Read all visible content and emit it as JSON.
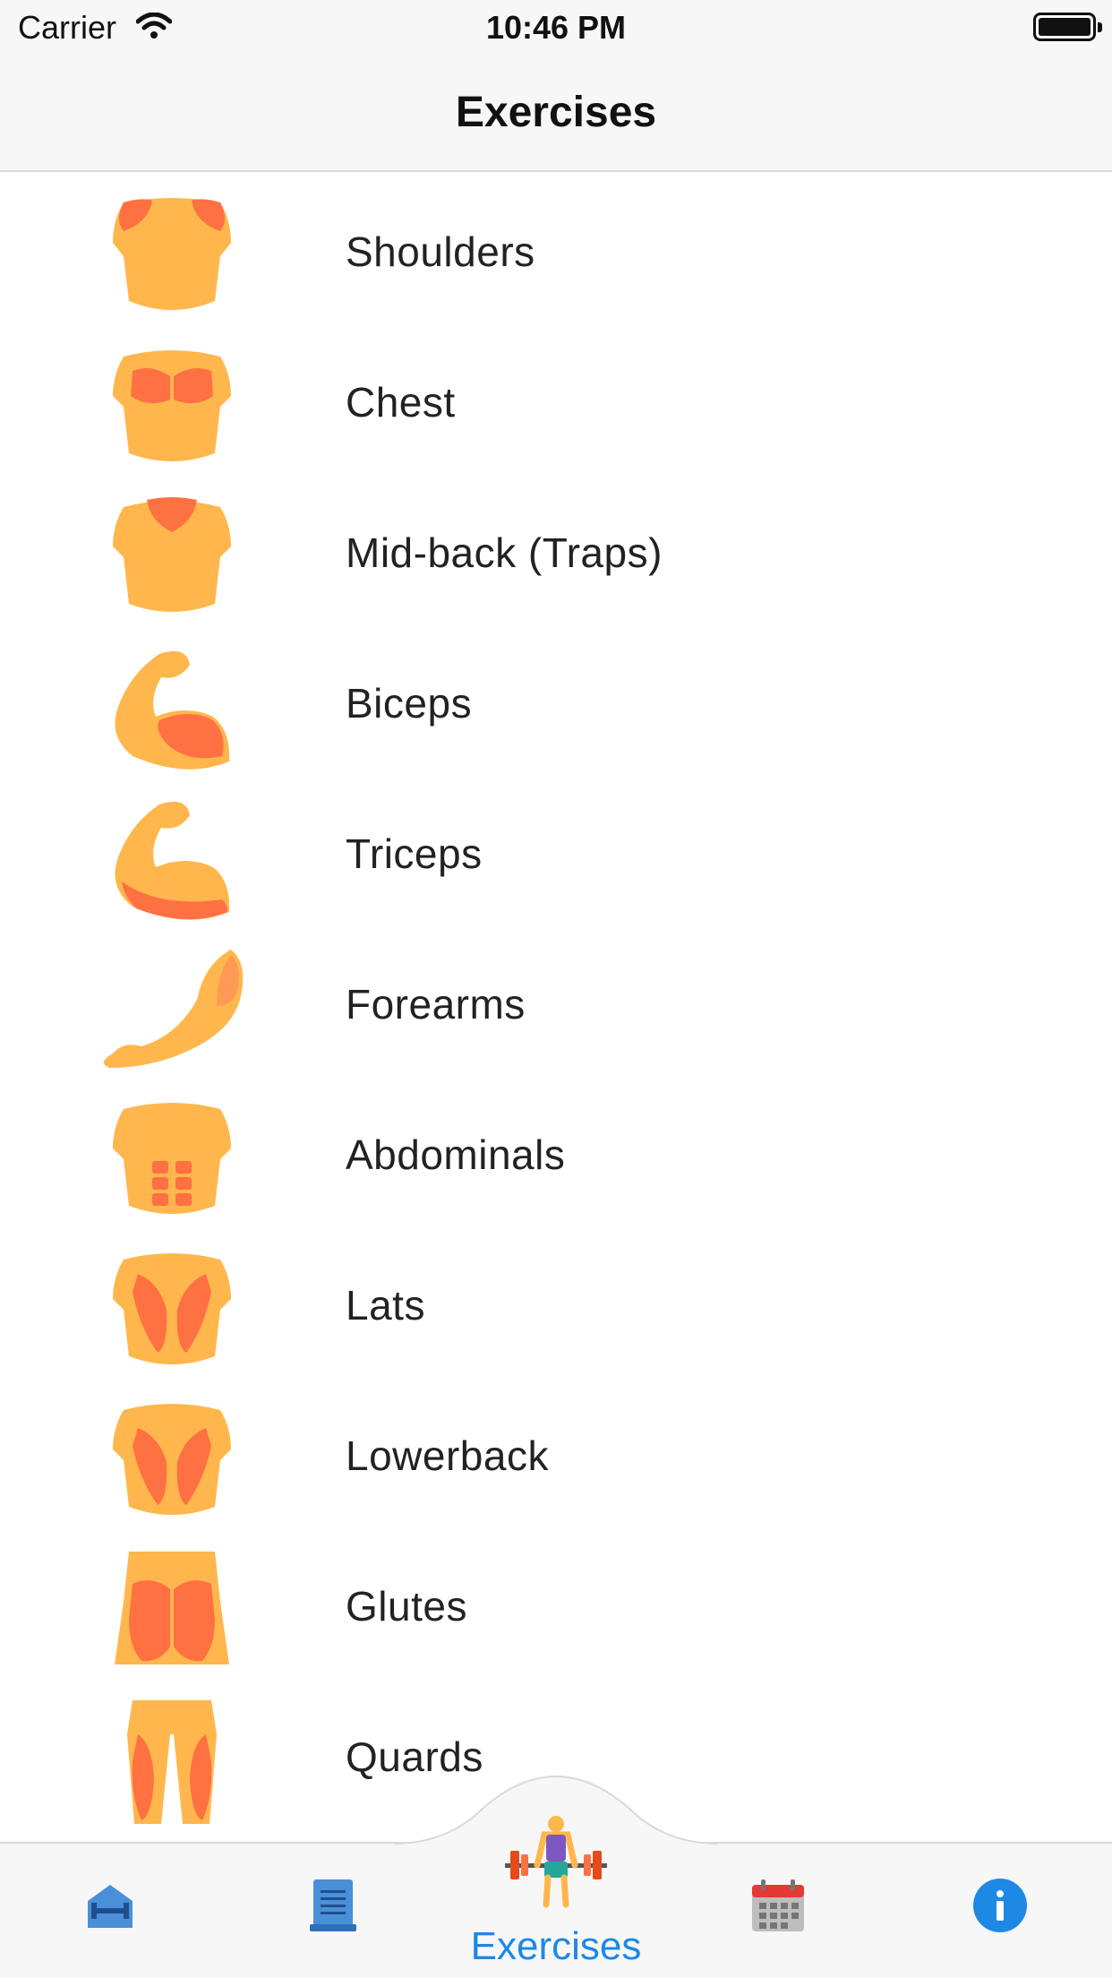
{
  "status_bar": {
    "carrier": "Carrier",
    "time": "10:46 PM"
  },
  "nav": {
    "title": "Exercises"
  },
  "muscles": [
    {
      "label": "Shoulders",
      "icon": "shoulders-icon"
    },
    {
      "label": "Chest",
      "icon": "chest-icon"
    },
    {
      "label": "Mid-back (Traps)",
      "icon": "mid-back-icon"
    },
    {
      "label": "Biceps",
      "icon": "biceps-icon"
    },
    {
      "label": "Triceps",
      "icon": "triceps-icon"
    },
    {
      "label": "Forearms",
      "icon": "forearms-icon"
    },
    {
      "label": "Abdominals",
      "icon": "abdominals-icon"
    },
    {
      "label": "Lats",
      "icon": "lats-icon"
    },
    {
      "label": "Lowerback",
      "icon": "lowerback-icon"
    },
    {
      "label": "Glutes",
      "icon": "glutes-icon"
    },
    {
      "label": "Quards",
      "icon": "quads-icon"
    }
  ],
  "tab_bar": {
    "active_label": "Exercises",
    "tabs": [
      "dumbbell-icon",
      "list-icon",
      "weightlifter-icon",
      "calendar-icon",
      "info-icon"
    ]
  },
  "colors": {
    "skin": "#ffb74d",
    "muscle": "#ff7043",
    "accent": "#1e88e5"
  }
}
